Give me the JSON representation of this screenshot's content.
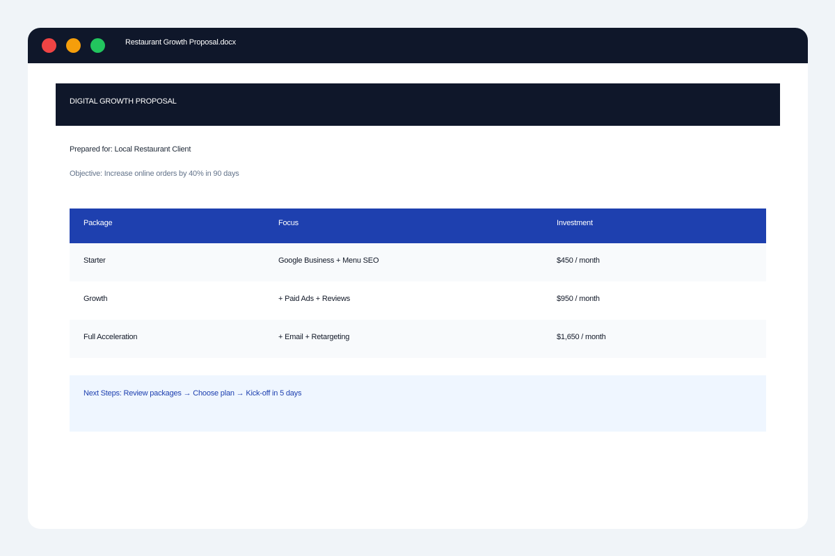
{
  "colors": {
    "page_background": "#f0f4f8",
    "titlebar": "#0f172a",
    "close": "#ef4444",
    "minimize": "#f59e0b",
    "maximize": "#22c55e",
    "table_header": "#1e40af",
    "callout_background": "#eff6ff",
    "callout_text": "#1e40af"
  },
  "window": {
    "title": "Restaurant Growth Proposal.docx",
    "controls": [
      "close",
      "minimize",
      "maximize"
    ]
  },
  "document": {
    "header_title": "DIGITAL GROWTH PROPOSAL",
    "prepared_for": "Prepared for: Local Restaurant Client",
    "objective": "Objective: Increase online orders by 40% in 90 days",
    "table": {
      "headers": [
        "Package",
        "Focus",
        "Investment"
      ],
      "rows": [
        [
          "Starter",
          "Google Business + Menu SEO",
          "$450 / month"
        ],
        [
          "Growth",
          "+ Paid Ads + Reviews",
          "$950 / month"
        ],
        [
          "Full Acceleration",
          "+ Email + Retargeting",
          "$1,650 / month"
        ]
      ]
    },
    "next_steps": "Next Steps: Review packages → Choose plan → Kick-off in 5 days"
  }
}
